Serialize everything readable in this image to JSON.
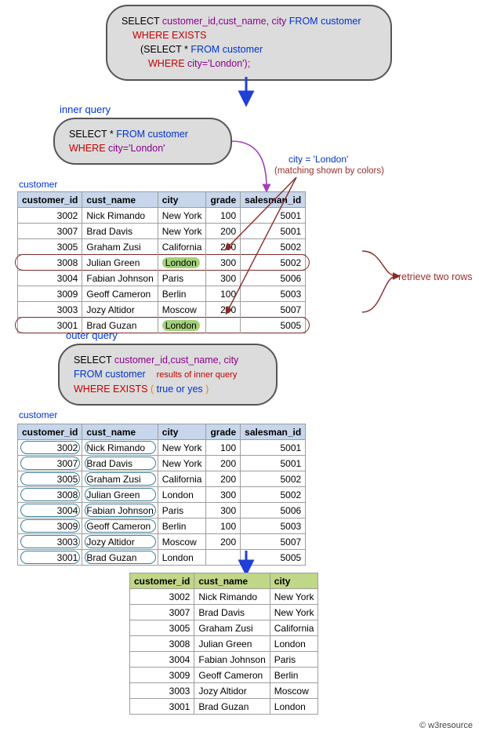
{
  "main_query": {
    "select": "SELECT",
    "cols": "customer_id,cust_name, city",
    "from": "FROM",
    "tbl": "customer",
    "where_exists": "WHERE EXISTS",
    "open_paren": "(",
    "inner_select": "SELECT *",
    "inner_from": "FROM",
    "inner_tbl": "customer",
    "inner_where": "WHERE",
    "inner_cond": "city='London');"
  },
  "labels": {
    "inner_query": "inner query",
    "outer_query": "outer query",
    "customer": "customer",
    "city_eq": "city = 'London'",
    "matching_note": "(matching shown by colors)",
    "retrieve": "retrieve two rows",
    "results_note": "results of inner query",
    "true_or_yes": "true or yes"
  },
  "inner_box": {
    "select": "SELECT *",
    "from": "FROM",
    "tbl": "customer",
    "where": "WHERE",
    "cond": "city='London'"
  },
  "outer_box": {
    "select": "SELECT",
    "cols": "customer_id,cust_name, city",
    "from": "FROM",
    "tbl": "customer",
    "where_exists": "WHERE EXISTS",
    "open_paren": "(",
    "close_paren": ")"
  },
  "table_headers": [
    "customer_id",
    "cust_name",
    "city",
    "grade",
    "salesman_id"
  ],
  "customers": [
    {
      "customer_id": 3002,
      "cust_name": "Nick Rimando",
      "city": "New York",
      "grade": 100,
      "salesman_id": 5001,
      "london": false
    },
    {
      "customer_id": 3007,
      "cust_name": "Brad Davis",
      "city": "New York",
      "grade": 200,
      "salesman_id": 5001,
      "london": false
    },
    {
      "customer_id": 3005,
      "cust_name": "Graham Zusi",
      "city": "California",
      "grade": 200,
      "salesman_id": 5002,
      "london": false
    },
    {
      "customer_id": 3008,
      "cust_name": "Julian Green",
      "city": "London",
      "grade": 300,
      "salesman_id": 5002,
      "london": true
    },
    {
      "customer_id": 3004,
      "cust_name": "Fabian Johnson",
      "city": "Paris",
      "grade": 300,
      "salesman_id": 5006,
      "london": false
    },
    {
      "customer_id": 3009,
      "cust_name": "Geoff Cameron",
      "city": "Berlin",
      "grade": 100,
      "salesman_id": 5003,
      "london": false
    },
    {
      "customer_id": 3003,
      "cust_name": "Jozy Altidor",
      "city": "Moscow",
      "grade": 200,
      "salesman_id": 5007,
      "london": false
    },
    {
      "customer_id": 3001,
      "cust_name": "Brad Guzan",
      "city": "London",
      "grade": "",
      "salesman_id": 5005,
      "london": true
    }
  ],
  "result_headers": [
    "customer_id",
    "cust_name",
    "city"
  ],
  "copyright": "© w3resource"
}
